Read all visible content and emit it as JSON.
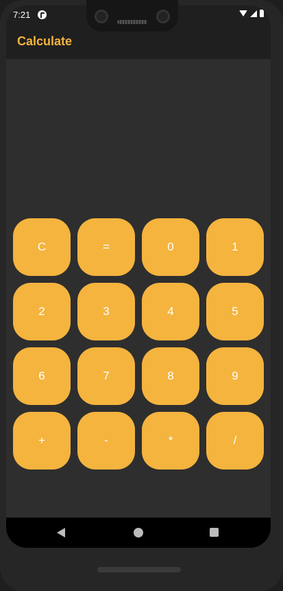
{
  "status_bar": {
    "time": "7:21"
  },
  "app_bar": {
    "title": "Calculate"
  },
  "colors": {
    "accent": "#f4b43e",
    "background": "#2e2e2e",
    "app_bar": "#1f1f1f"
  },
  "keypad": {
    "keys": [
      "C",
      "=",
      "0",
      "1",
      "2",
      "3",
      "4",
      "5",
      "6",
      "7",
      "8",
      "9",
      "+",
      "-",
      "*",
      "/"
    ]
  },
  "nav_bar": {
    "icons": [
      "back-icon",
      "home-icon",
      "recents-icon"
    ]
  }
}
